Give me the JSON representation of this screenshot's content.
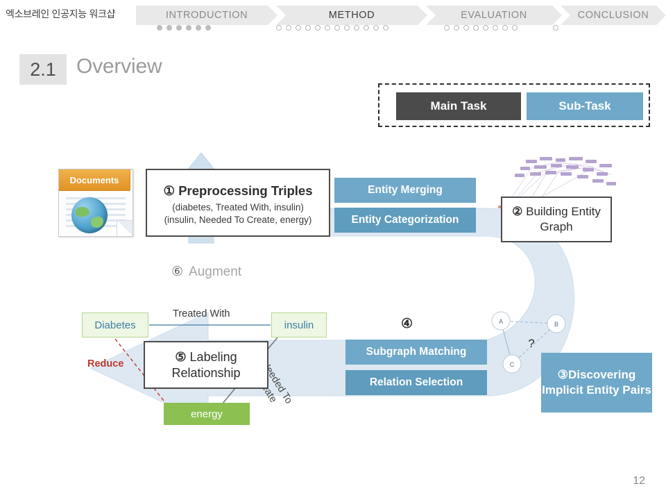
{
  "header": {
    "title": "엑소브레인 인공지능 워크샵",
    "nav": [
      {
        "label": "INTRODUCTION",
        "dots_total": 6,
        "dots_filled": 6,
        "active": false
      },
      {
        "label": "METHOD",
        "dots_total": 12,
        "dots_filled": 0,
        "active": true
      },
      {
        "label": "EVALUATION",
        "dots_total": 8,
        "dots_filled": 0,
        "active": false
      },
      {
        "label": "CONCLUSION",
        "dots_total": 1,
        "dots_filled": 0,
        "active": false
      }
    ]
  },
  "slide": {
    "number": "2.1",
    "title": "Overview",
    "page_number": "12"
  },
  "legend": {
    "main_task": "Main Task",
    "sub_task": "Sub-Task",
    "main_color": "#4b4b4b",
    "sub_color": "#6fa8c8"
  },
  "documents": {
    "label": "Documents",
    "icon": "globe-document-icon"
  },
  "steps": [
    {
      "marker": "①",
      "title": "Preprocessing Triples",
      "detail_line_1": "(diabetes, Treated With, insulin)",
      "detail_line_2": "(insulin, Needed To Create, energy)"
    },
    {
      "marker": "②",
      "title": "Building Entity Graph"
    },
    {
      "marker": "③",
      "title": "Discovering Implicit Entity Pairs"
    },
    {
      "marker": "④",
      "title": ""
    },
    {
      "marker": "⑤",
      "title": "Labeling Relationship"
    },
    {
      "marker": "⑥",
      "title": "Augment"
    }
  ],
  "subtasks": {
    "entity_merging": "Entity Merging",
    "entity_categorization": "Entity Categorization",
    "subgraph_matching": "Subgraph Matching",
    "relation_selection": "Relation Selection"
  },
  "triple_graph": {
    "nodes": [
      {
        "id": "diabetes",
        "label": "Diabetes",
        "style": "green-outline"
      },
      {
        "id": "insulin",
        "label": "insulin",
        "style": "green-outline"
      },
      {
        "id": "energy",
        "label": "energy",
        "style": "green-fill"
      }
    ],
    "edges": [
      {
        "label": "Treated With",
        "from": "diabetes",
        "to": "insulin",
        "color": "#5b8fb5"
      },
      {
        "label": "Needed To Create",
        "from": "insulin",
        "to": "energy",
        "color": "#6f6f6f"
      },
      {
        "label": "Reduce",
        "from": "diabetes",
        "to": "energy",
        "color": "#c0392b",
        "dashed": true
      }
    ]
  },
  "abc_graph": {
    "nodes": [
      {
        "id": "A",
        "label": "A"
      },
      {
        "id": "B",
        "label": "B"
      },
      {
        "id": "C",
        "label": "C"
      }
    ],
    "unknown_edge_label": "?"
  },
  "colors": {
    "accent_blue": "#6fa8c8",
    "arrow_fill": "#dbe7f1",
    "green_node": "#8cc152",
    "red_edge": "#c0392b",
    "doc_orange": "#e09226"
  }
}
